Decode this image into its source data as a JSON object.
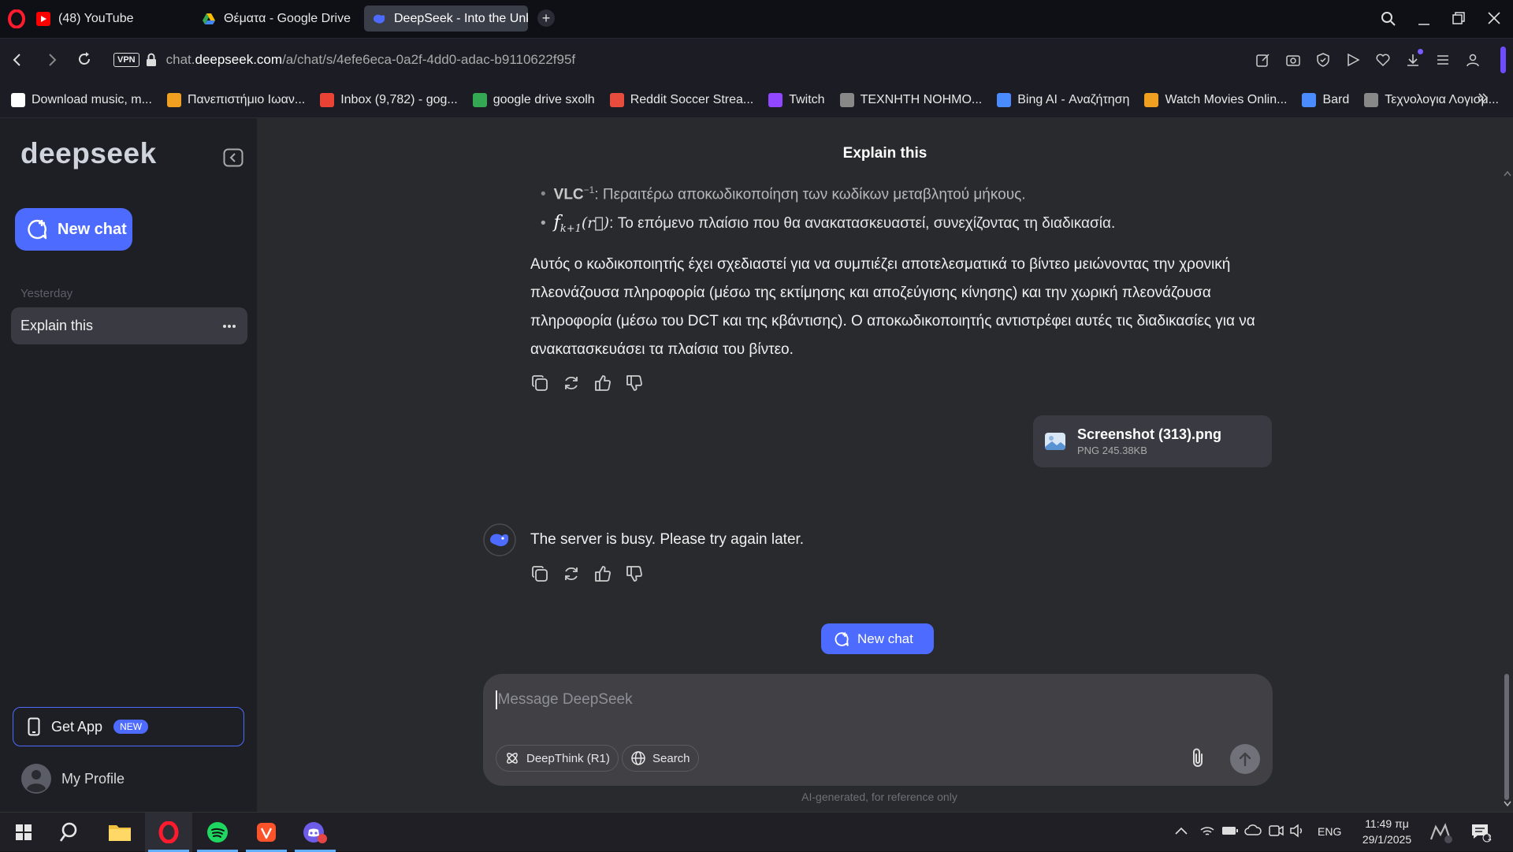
{
  "browser": {
    "tabs": [
      {
        "label": "(48) YouTube",
        "icon": "youtube-icon"
      },
      {
        "label": "Θέματα - Google Drive",
        "icon": "google-drive-icon"
      },
      {
        "label": "DeepSeek - Into the Unkn",
        "icon": "deepseek-icon",
        "active": true
      }
    ],
    "url_prefix": "chat.",
    "url_domain": "deepseek.com",
    "url_path": "/a/chat/s/4efe6eca-0a2f-4dd0-adac-b9110622f95f",
    "vpn_label": "VPN",
    "bookmarks": [
      {
        "label": "Download music, m...",
        "icon": "music-download-icon",
        "color": "#ffffff"
      },
      {
        "label": "Πανεπιστήμιο Ιωαν...",
        "icon": "university-icon",
        "color": "#f0a020"
      },
      {
        "label": "Inbox (9,782) - gog...",
        "icon": "gmail-icon",
        "color": "#ea4335"
      },
      {
        "label": "google drive sxolh",
        "icon": "google-drive-icon",
        "color": "#34a853"
      },
      {
        "label": "Reddit Soccer Strea...",
        "icon": "soccer-icon",
        "color": "#e74c3c"
      },
      {
        "label": "Twitch",
        "icon": "twitch-icon",
        "color": "#9146ff"
      },
      {
        "label": "ΤΕΧΝΗΤΗ ΝΟΗΜΟ...",
        "icon": "ai-icon",
        "color": "#888888"
      },
      {
        "label": "Bing AI - Αναζήτηση",
        "icon": "bing-icon",
        "color": "#4a8cff"
      },
      {
        "label": "Watch Movies Onlin...",
        "icon": "hd-icon",
        "color": "#f0a020"
      },
      {
        "label": "Bard",
        "icon": "bard-icon",
        "color": "#4a8cff"
      },
      {
        "label": "Τεχνολογια Λογισμ...",
        "icon": "software-icon",
        "color": "#888888"
      }
    ]
  },
  "sidebar": {
    "logo": "deepseek",
    "new_chat_label": "New chat",
    "section_label": "Yesterday",
    "chats": [
      {
        "label": "Explain this"
      }
    ],
    "get_app_label": "Get App",
    "new_badge": "NEW",
    "profile_label": "My Profile"
  },
  "chat": {
    "title": "Explain this",
    "bullets": [
      {
        "term": "VLC",
        "sup": "−1",
        "text": ": Περαιτέρω αποκωδικοποίηση των κωδίκων μεταβλητού μήκους."
      },
      {
        "term": "f",
        "sub": "k+1",
        "arg": "(r⃗)",
        "text": ": Το επόμενο πλαίσιο που θα ανακατασκευαστεί, συνεχίζοντας τη διαδικασία."
      }
    ],
    "paragraph": "Αυτός ο κωδικοποιητής έχει σχεδιαστεί για να συμπιέζει αποτελεσματικά το βίντεο μειώνοντας την χρονική πλεονάζουσα πληροφορία (μέσω της εκτίμησης και αποζεύγισης κίνησης) και την χωρική πλεονάζουσα πληροφορία (μέσω του DCT και της κβάντισης). Ο αποκωδικοποιητής αντιστρέφει αυτές τις διαδικασίες για να ανακατασκευάσει τα πλαίσια του βίντεο.",
    "attachment": {
      "name": "Screenshot (313).png",
      "meta": "PNG 245.38KB"
    },
    "error_message": "The server is busy. Please try again later.",
    "new_chat_label": "New chat",
    "input_placeholder": "Message DeepSeek",
    "deepthink_label": "DeepThink (R1)",
    "search_label": "Search",
    "disclaimer": "AI-generated, for reference only"
  },
  "taskbar": {
    "language": "ENG",
    "time": "11:49 πμ",
    "date": "29/1/2025",
    "notification_count": "1"
  },
  "colors": {
    "accent": "#4d6bfe",
    "sidebar_bg": "#1e1f25",
    "main_bg": "#292a2d"
  }
}
